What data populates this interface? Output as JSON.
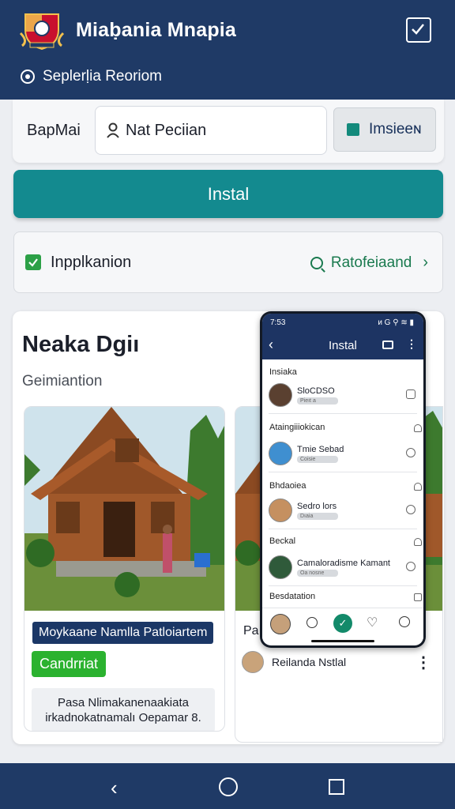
{
  "header": {
    "app_title": "Miaḅania Mnapia",
    "region": "Seplerḷia Reoriom",
    "logo_icon": "crest-logo",
    "check_icon": "check-square-icon"
  },
  "search": {
    "label": "BapMai",
    "value": "Nat Peciian",
    "filter_label": "Imsieeɴ"
  },
  "install_button": "Instal",
  "option": {
    "label": "Inpplkanion",
    "link_label": "Ratofeiaand"
  },
  "main": {
    "title": "Neaka Dgiı",
    "subtitle": "Geimiantion",
    "card1": {
      "name": "Moykaane Namlla Patloiartem",
      "badge": "Candrriat",
      "desc_line1": "Pasa Nlimakanenaakiata",
      "desc_line2": "irkadnokatnamalı Oepamar 8."
    },
    "card2": {
      "label": "Pa",
      "author": "Reilanda Nstlal"
    }
  },
  "phone": {
    "time": "7:53",
    "status": "ᴎ G ⚲ ≋ ▮",
    "title": "Instal",
    "items": [
      {
        "section": "Insiaka",
        "name": "SloCDSO",
        "tag": "Pieıt a"
      },
      {
        "section": "Ataingiiiokican",
        "name": "Tmie Sebad",
        "tag": "Coisie"
      },
      {
        "section": "Bhdaoiea",
        "name": "Sedro lors",
        "tag": "Dıaia"
      },
      {
        "section": "Beckal",
        "name": "Camaloradisme Kamant",
        "tag": "Oa nosne"
      },
      {
        "section": "Besdatation",
        "name": "",
        "tag": ""
      }
    ]
  },
  "colors": {
    "header": "#1f3a66",
    "install": "#138a8f",
    "badge": "#2bb22f",
    "check": "#2ca047"
  }
}
